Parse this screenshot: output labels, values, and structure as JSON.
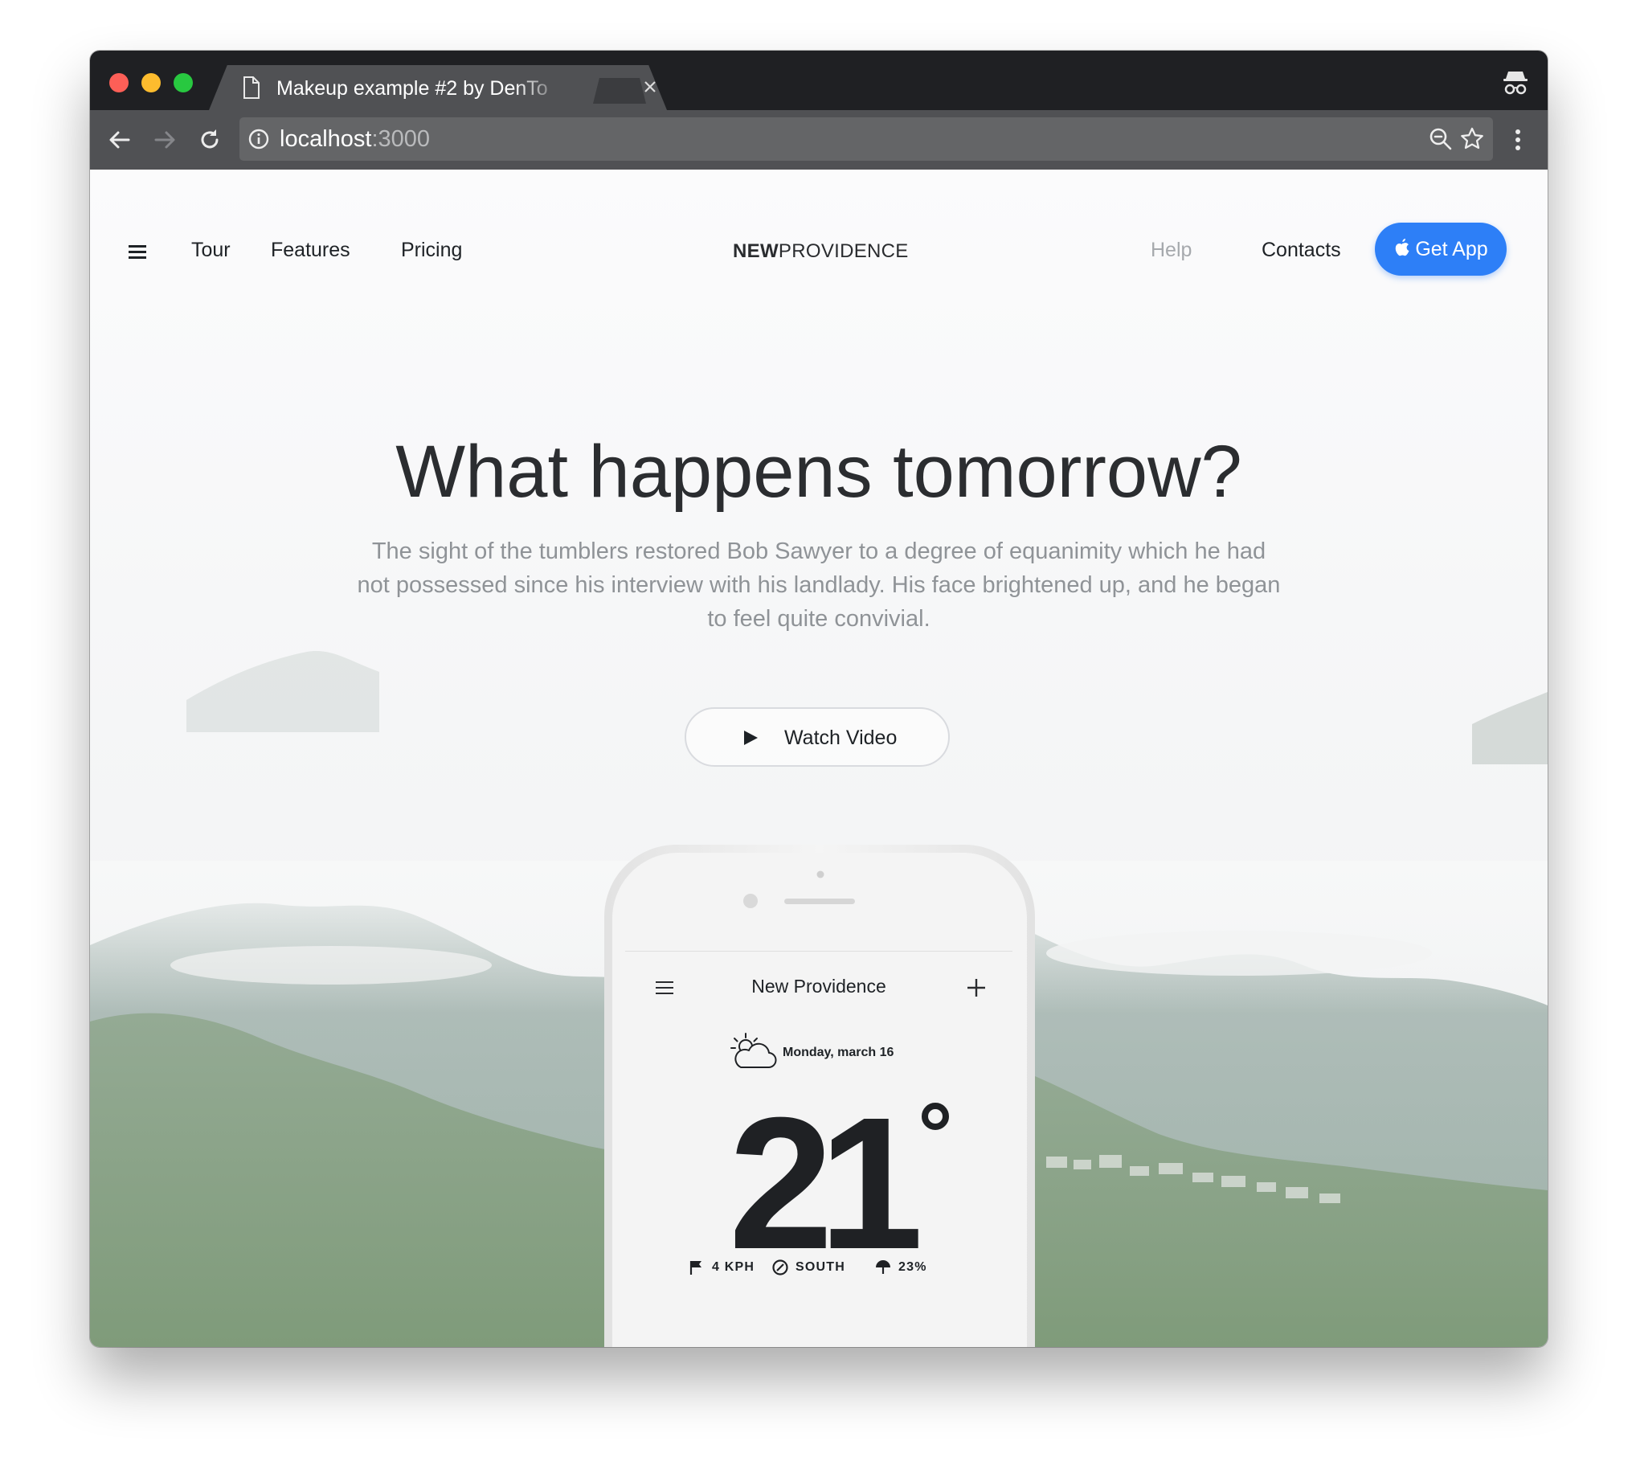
{
  "browser": {
    "tab_title": "Makeup example #2 by DenTo",
    "url_host": "localhost",
    "url_port": ":3000"
  },
  "nav": {
    "left_links": [
      "Tour",
      "Features",
      "Pricing"
    ],
    "logo_bold": "NEW",
    "logo_light": "PROVIDENCE",
    "help": "Help",
    "contacts": "Contacts",
    "cta_label": "Get App"
  },
  "hero": {
    "title": "What happens tomorrow?",
    "text": "The sight of the tumblers restored Bob Sawyer to a degree of equanimity which he had not possessed since his interview with his landlady. His face brightened up, and he began to feel quite convivial.",
    "watch_label": "Watch Video"
  },
  "phone": {
    "title": "New Providence",
    "date": "Monday, march 16",
    "temperature": "21",
    "stats": {
      "wind": "4 KPH",
      "direction": "SOUTH",
      "rain": "23%"
    }
  },
  "colors": {
    "accent": "#2d7ff7",
    "titlebar": "#1f2023",
    "toolbar": "#505154",
    "heading": "#2b2d30",
    "body_text": "#8f9397"
  },
  "icons": {
    "tab": "document-icon",
    "close": "close-icon",
    "incognito": "incognito-icon",
    "back": "back-arrow-icon",
    "forward": "forward-arrow-icon",
    "reload": "reload-icon",
    "info": "info-icon",
    "zoom": "zoom-icon",
    "bookmark": "star-icon",
    "menu": "more-vert-icon",
    "cta": "apple-icon",
    "watch": "play-icon"
  }
}
